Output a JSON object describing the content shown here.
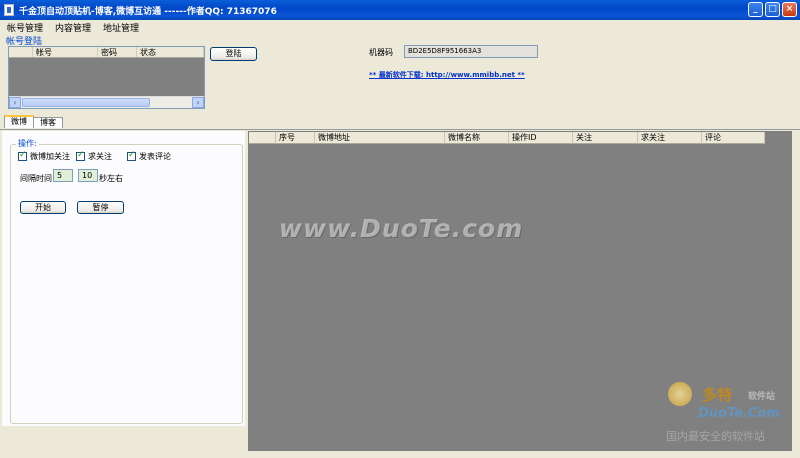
{
  "window": {
    "title": "千金顶自动顶贴机-博客,微博互访通 ------作者QQ: 71367076"
  },
  "menu": [
    "帐号管理",
    "内容管理",
    "地址管理"
  ],
  "login_section": {
    "title": "帐号登陆",
    "columns": [
      "帐号",
      "密码",
      "状态"
    ],
    "login_button": "登陆"
  },
  "machine": {
    "label": "机器码",
    "code": "BD2E5D8F951663A3"
  },
  "download_link": "** 最新软件下载: http://www.mmibb.net **",
  "tabs": [
    "微博",
    "博客"
  ],
  "ops": {
    "legend": "操作:",
    "checkboxes": [
      "微博加关注",
      "求关注",
      "发表评论"
    ],
    "interval_label": "间隔时间",
    "interval_min": "5",
    "interval_max": "10",
    "interval_unit": "秒左右",
    "start_button": "开始",
    "pause_button": "暂停"
  },
  "grid_columns": [
    "序号",
    "微博地址",
    "微博名称",
    "操作ID",
    "关注",
    "求关注",
    "评论"
  ],
  "watermark": "www.DuoTe.com",
  "logo": {
    "name": "多特",
    "sub": "软件站",
    "domain": "DuoTe.Com",
    "slogan": "国内最安全的软件站"
  }
}
